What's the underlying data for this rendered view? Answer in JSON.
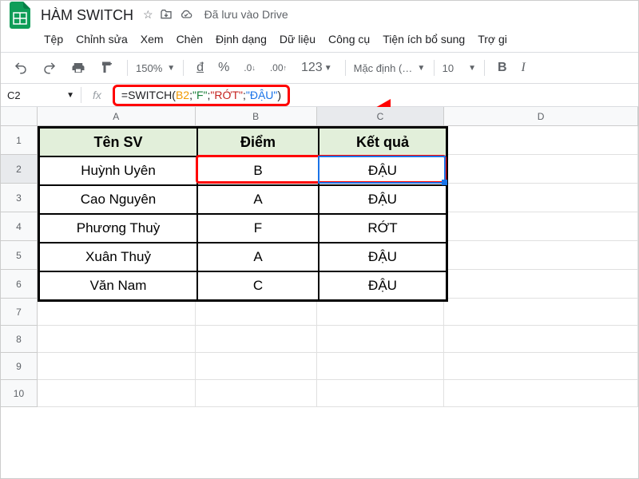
{
  "doc": {
    "title": "HÀM SWITCH",
    "saved": "Đã lưu vào Drive"
  },
  "menu": {
    "file": "Tệp",
    "edit": "Chỉnh sửa",
    "view": "Xem",
    "insert": "Chèn",
    "format": "Định dạng",
    "data": "Dữ liệu",
    "tools": "Công cụ",
    "ext": "Tiện ích bổ sung",
    "help": "Trợ gi"
  },
  "toolbar": {
    "zoom": "150%",
    "currency": "đ",
    "percent": "%",
    "dec0": ".0",
    "dec00": ".00",
    "num": "123",
    "font": "Mặc định (…",
    "size": "10",
    "bold": "B",
    "italic": "I"
  },
  "formula": {
    "cellref": "C2",
    "fx": "fx",
    "eq": "=",
    "fn": "SWITCH",
    "p1": "(",
    "ref": "B2",
    "s1": ";",
    "str1": "\"F\"",
    "s2": ";",
    "str2": "\"RỚT\"",
    "s3": ";",
    "str3": "\"ĐẬU\"",
    "p2": ")"
  },
  "cols": {
    "A": "A",
    "B": "B",
    "C": "C",
    "D": "D"
  },
  "rows": {
    "r1": "1",
    "r2": "2",
    "r3": "3",
    "r4": "4",
    "r5": "5",
    "r6": "6",
    "r7": "7",
    "r8": "8",
    "r9": "9",
    "r10": "10"
  },
  "headers": {
    "name": "Tên SV",
    "score": "Điểm",
    "result": "Kết quả"
  },
  "data": {
    "r2": {
      "name": "Huỳnh Uyên",
      "score": "B",
      "result": "ĐẬU"
    },
    "r3": {
      "name": "Cao Nguyên",
      "score": "A",
      "result": "ĐẬU"
    },
    "r4": {
      "name": "Phương Thuỳ",
      "score": "F",
      "result": "RỚT"
    },
    "r5": {
      "name": "Xuân Thuỷ",
      "score": "A",
      "result": "ĐẬU"
    },
    "r6": {
      "name": "Văn Nam",
      "score": "C",
      "result": "ĐẬU"
    }
  },
  "chart_data": {
    "type": "table",
    "columns": [
      "Tên SV",
      "Điểm",
      "Kết quả"
    ],
    "rows": [
      [
        "Huỳnh Uyên",
        "B",
        "ĐẬU"
      ],
      [
        "Cao Nguyên",
        "A",
        "ĐẬU"
      ],
      [
        "Phương Thuỳ",
        "F",
        "RỚT"
      ],
      [
        "Xuân Thuỷ",
        "A",
        "ĐẬU"
      ],
      [
        "Văn Nam",
        "C",
        "ĐẬU"
      ]
    ]
  }
}
